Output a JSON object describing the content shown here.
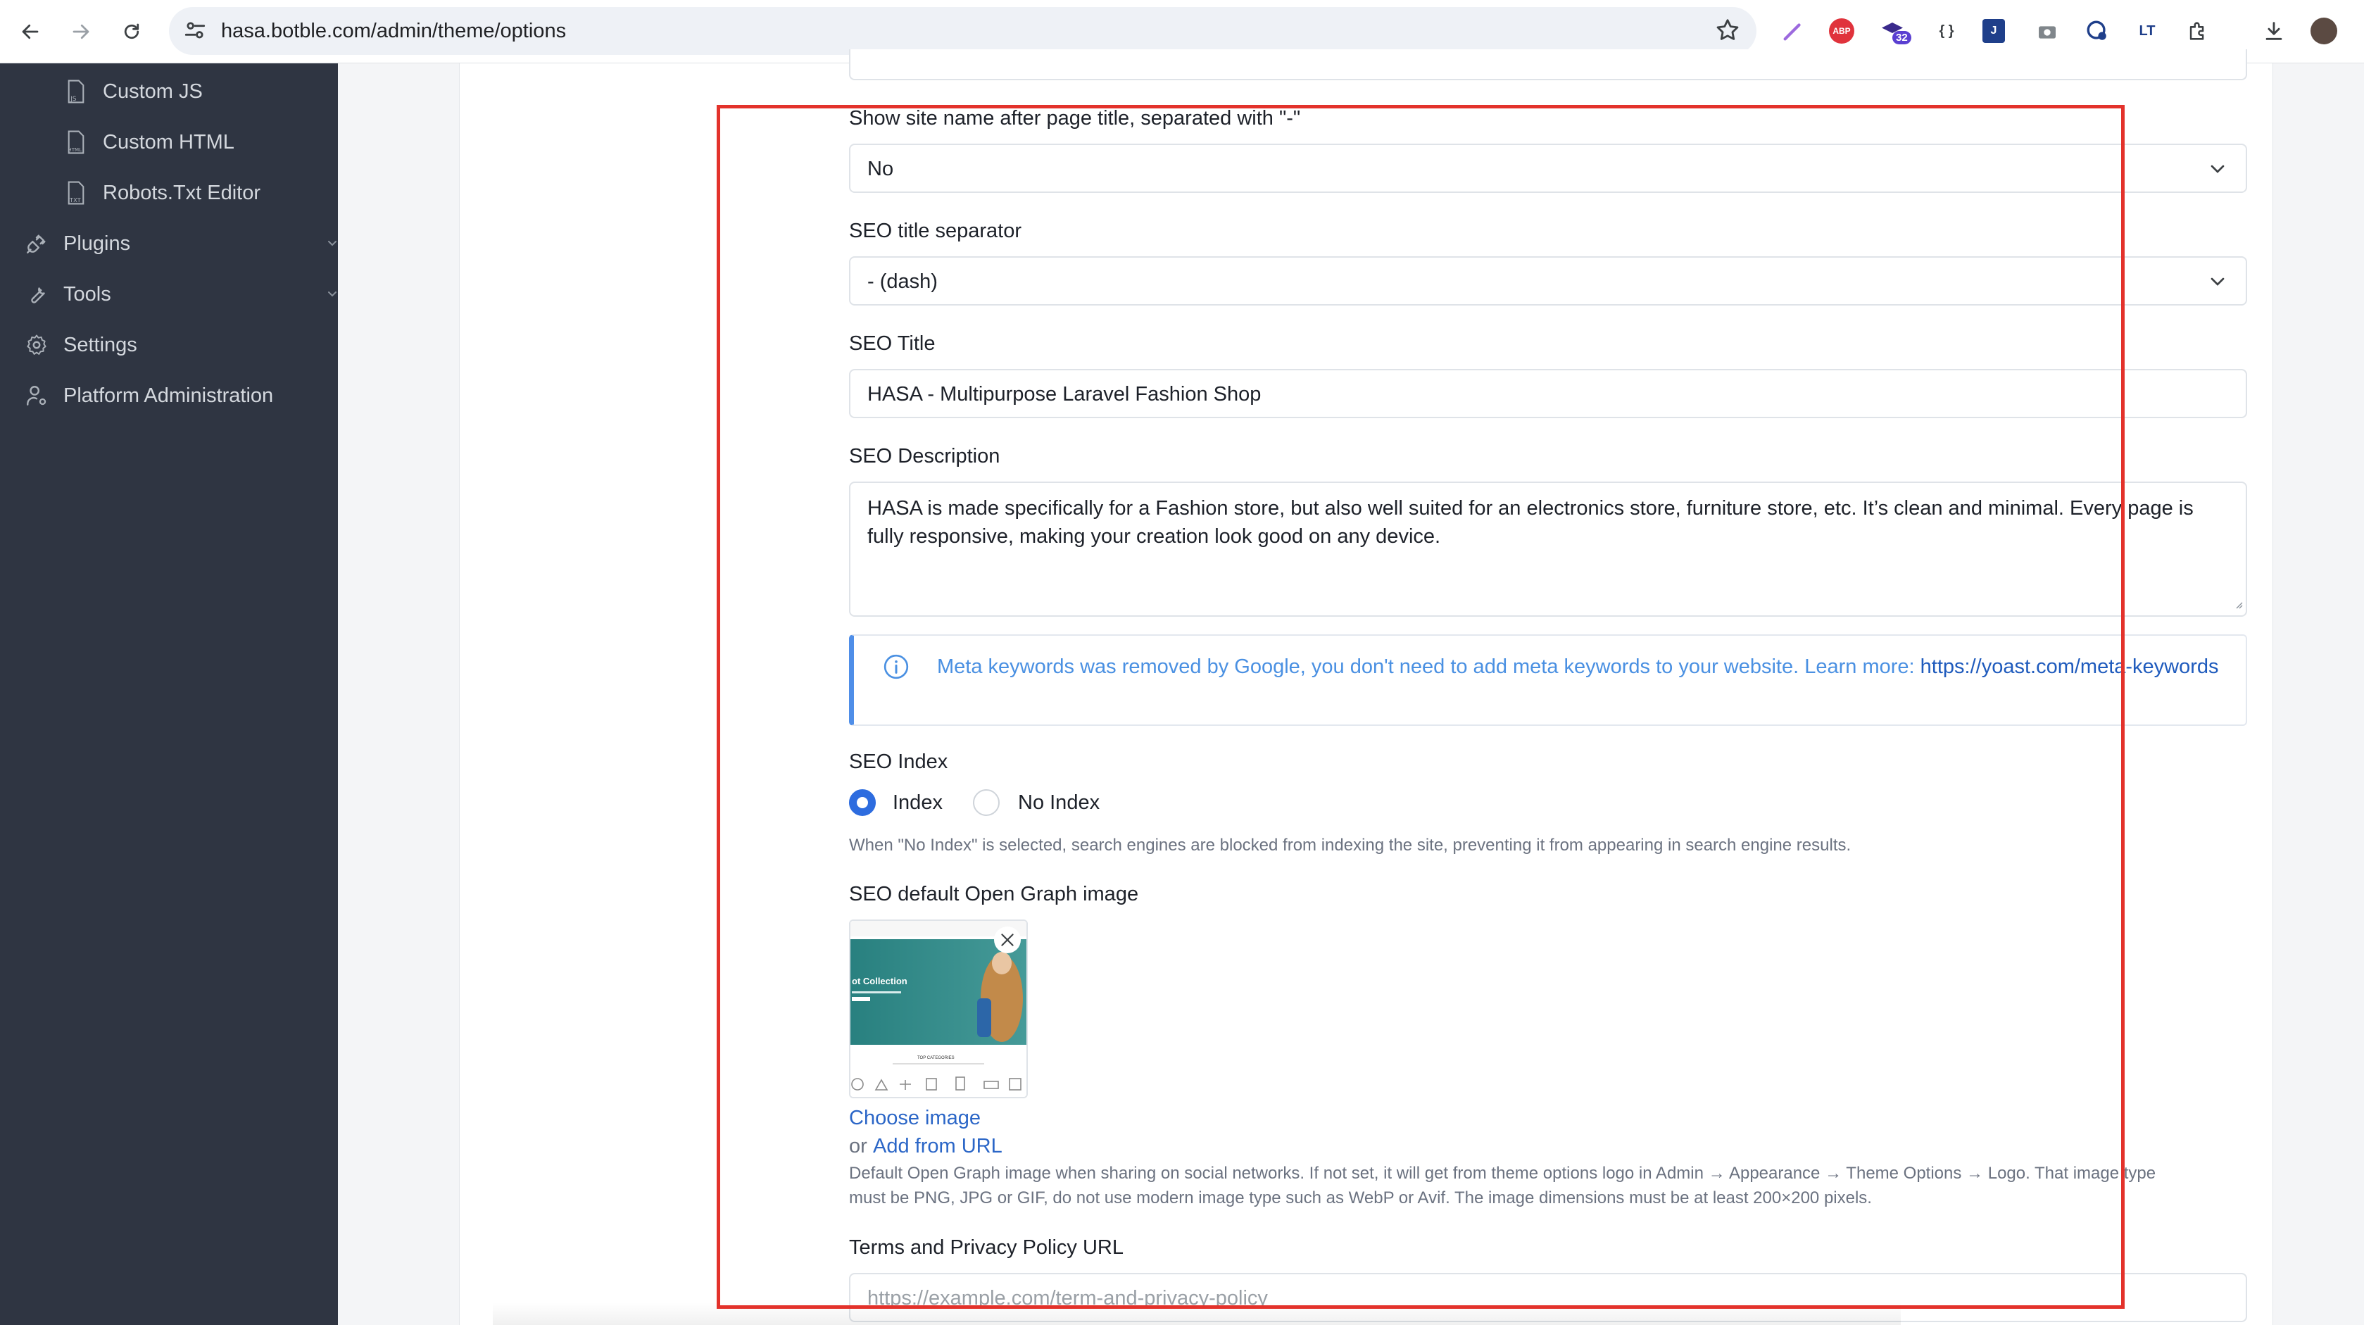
{
  "browser": {
    "url": "hasa.botble.com/admin/theme/options",
    "extension_badge": "32",
    "abp_label": "ABP"
  },
  "sidebar": {
    "items": [
      {
        "label": "Custom JS",
        "icon": "file-js-icon"
      },
      {
        "label": "Custom HTML",
        "icon": "file-html-icon"
      },
      {
        "label": "Robots.Txt Editor",
        "icon": "file-txt-icon"
      },
      {
        "label": "Plugins",
        "icon": "plug-icon"
      },
      {
        "label": "Tools",
        "icon": "wrench-icon"
      },
      {
        "label": "Settings",
        "icon": "gear-icon"
      },
      {
        "label": "Platform Administration",
        "icon": "user-cog-icon"
      }
    ]
  },
  "form": {
    "site_name_label": "Show site name after page title, separated with \"-\"",
    "site_name_value": "No",
    "separator_label": "SEO title separator",
    "separator_value": "- (dash)",
    "seo_title_label": "SEO Title",
    "seo_title_value": "HASA - Multipurpose Laravel Fashion Shop",
    "seo_description_label": "SEO Description",
    "seo_description_value": "HASA is made specifically for a Fashion store, but also well suited for an electronics store, furniture store, etc. It’s clean and minimal. Every page is fully responsive, making your creation look good on any device.",
    "meta_alert_text": "Meta keywords was removed by Google, you don't need to add meta keywords to your website. Learn more: ",
    "meta_alert_link": "https://yoast.com/meta-keywords",
    "seo_index_label": "SEO Index",
    "index_option": "Index",
    "noindex_option": "No Index",
    "seo_index_selected": "Index",
    "seo_index_help": "When \"No Index\" is selected, search engines are blocked from indexing the site, preventing it from appearing in search engine results.",
    "og_image_label": "SEO default Open Graph image",
    "og_thumb_collection_text": "ot Collection",
    "og_thumb_categories_text": "TOP CATEGORIES",
    "choose_image": "Choose image",
    "or_text": "or",
    "add_from_url": "Add from URL",
    "og_help_line1": "Default Open Graph image when sharing on social networks. If not set, it will get from theme options logo in Admin → Appearance → Theme Options → Logo. That image type",
    "og_help_line2": "must be PNG, JPG or GIF, do not use modern image type such as WebP or Avif. The image dimensions must be at least 200×200 pixels.",
    "terms_label": "Terms and Privacy Policy URL",
    "terms_placeholder": "https://example.com/term-and-privacy-policy"
  },
  "colors": {
    "sidebar_bg": "#2f3542",
    "accent": "#2d6cdf",
    "highlight_box": "#e3322b"
  }
}
